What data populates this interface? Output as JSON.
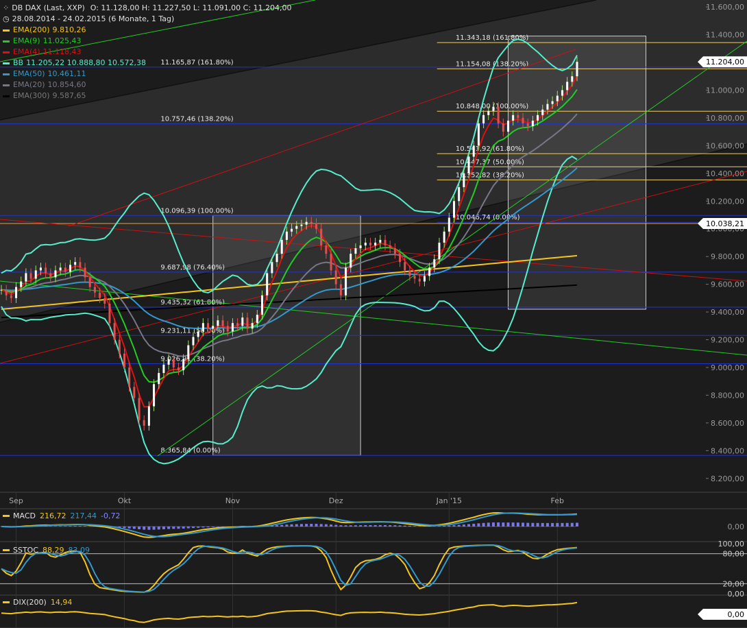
{
  "header": {
    "title": "DB DAX (Last, XXP)",
    "ohlc": "O: 11.128,00  H: 11.227,50  L: 11.091,00  C: 11.204,00",
    "period": "28.08.2014 - 24.02.2015 (6 Monate, 1 Tag)"
  },
  "legend": [
    {
      "label": "EMA(200)",
      "value": "9.810,26",
      "color": "#f5c518"
    },
    {
      "label": "EMA(9)",
      "value": "11.025,43",
      "color": "#22cc22"
    },
    {
      "label": "EMA(4)",
      "value": "11.118,43",
      "color": "#dd1111"
    },
    {
      "label": "BB",
      "value": "11.205,22  10.888,80  10.572,38",
      "color": "#55eecc"
    },
    {
      "label": "EMA(50)",
      "value": "10.461,11",
      "color": "#3399cc"
    },
    {
      "label": "EMA(20)",
      "value": "10.854,60",
      "color": "#777788"
    },
    {
      "label": "EMA(300)",
      "value": "9.587,65",
      "color": "#111111"
    }
  ],
  "price_badges": [
    {
      "value": "11.204,00",
      "price": 11204
    },
    {
      "value": "10.038,21",
      "price": 10038
    }
  ],
  "chart_data": {
    "type": "line",
    "title": "DB DAX (Last, XXP)",
    "ylim": [
      8100,
      11650
    ],
    "y_ticks": [
      {
        "v": 8200,
        "label": "8.200,00"
      },
      {
        "v": 8400,
        "label": "8.400,00"
      },
      {
        "v": 8600,
        "label": "8.600,00"
      },
      {
        "v": 8800,
        "label": "8.800,00"
      },
      {
        "v": 9000,
        "label": "9.000,00"
      },
      {
        "v": 9200,
        "label": "9.200,00"
      },
      {
        "v": 9400,
        "label": "9.400,00"
      },
      {
        "v": 9600,
        "label": "9.600,00"
      },
      {
        "v": 9800,
        "label": "9.800,00"
      },
      {
        "v": 10000,
        "label": "10.000,00"
      },
      {
        "v": 10200,
        "label": "10.200,00"
      },
      {
        "v": 10400,
        "label": "10.400,00"
      },
      {
        "v": 10600,
        "label": "10.600,00"
      },
      {
        "v": 10800,
        "label": "10.800,00"
      },
      {
        "v": 11000,
        "label": "11.000,00"
      },
      {
        "v": 11200,
        "label": "11.200,00"
      },
      {
        "v": 11400,
        "label": "11.400,00"
      },
      {
        "v": 11600,
        "label": "11.600,00"
      }
    ],
    "x_labels": [
      {
        "i": 3,
        "label": "Sep"
      },
      {
        "i": 25,
        "label": "Okt"
      },
      {
        "i": 47,
        "label": "Nov"
      },
      {
        "i": 68,
        "label": "Dez"
      },
      {
        "i": 91,
        "label": "Jan '15"
      },
      {
        "i": 113,
        "label": "Feb"
      }
    ],
    "fib_levels": [
      {
        "price": 11343,
        "label": "11.343,18 (161.80%)",
        "color": "#f0d060",
        "x0": 0.585,
        "labelX": 0.61
      },
      {
        "price": 11154,
        "label": "11.154,08 (138.20%)",
        "color": "#f0d060",
        "x0": 0.585,
        "labelX": 0.61
      },
      {
        "price": 11166,
        "label": "11.165,87 (161.80%)",
        "color": "#2233cc",
        "x0": 0.0,
        "labelX": 0.215
      },
      {
        "price": 10848,
        "label": "10.848,00 (100.00%)",
        "color": "#f0d060",
        "x0": 0.585,
        "labelX": 0.61
      },
      {
        "price": 10757,
        "label": "10.757,46 (138.20%)",
        "color": "#2233cc",
        "x0": 0.0,
        "labelX": 0.215
      },
      {
        "price": 10542,
        "label": "10.541,92 (61.80%)",
        "color": "#f0d060",
        "x0": 0.585,
        "labelX": 0.61
      },
      {
        "price": 10447,
        "label": "10.447,37 (50.00%)",
        "color": "#f0d060",
        "x0": 0.585,
        "labelX": 0.61
      },
      {
        "price": 10353,
        "label": "10.352,82 (38.20%)",
        "color": "#f0d060",
        "x0": 0.585,
        "labelX": 0.61
      },
      {
        "price": 10096,
        "label": "10.096,39 (100.00%)",
        "color": "#2233cc",
        "x0": 0.0,
        "labelX": 0.215
      },
      {
        "price": 10047,
        "label": "10.046,74 (0.00%)",
        "color": "#2233cc",
        "x0": 0.585,
        "labelX": 0.61
      },
      {
        "price": 9688,
        "label": "9.687,98 (76.40%)",
        "color": "#2233cc",
        "x0": 0.0,
        "labelX": 0.215
      },
      {
        "price": 9435,
        "label": "9.435,32 (61.80%)",
        "color": "#2233cc",
        "x0": 0.0,
        "labelX": 0.215
      },
      {
        "price": 9231,
        "label": "9.231,11 (50.00%)",
        "color": "#2233cc",
        "x0": 0.0,
        "labelX": 0.215
      },
      {
        "price": 9027,
        "label": "9.026,91 (38.20%)",
        "color": "#2233cc",
        "x0": 0.0,
        "labelX": 0.215
      },
      {
        "price": 8366,
        "label": "8.365,84 (0.00%)",
        "color": "#2233cc",
        "x0": 0.0,
        "labelX": 0.215
      }
    ],
    "support_line_price": 10038,
    "fib_boxes": [
      {
        "i0": 43,
        "i1": 73,
        "top": 10096,
        "bottom": 8366
      },
      {
        "i0": 103,
        "i1": 131,
        "top": 11390,
        "bottom": 9420
      }
    ],
    "close": [
      9560,
      9520,
      9500,
      9580,
      9620,
      9680,
      9640,
      9700,
      9720,
      9680,
      9650,
      9700,
      9720,
      9690,
      9740,
      9760,
      9720,
      9650,
      9580,
      9540,
      9500,
      9460,
      9320,
      9200,
      9100,
      9000,
      8860,
      8780,
      8620,
      8580,
      8720,
      8880,
      8960,
      9020,
      9060,
      9000,
      8980,
      9060,
      9160,
      9220,
      9260,
      9320,
      9280,
      9300,
      9340,
      9300,
      9260,
      9320,
      9300,
      9360,
      9280,
      9320,
      9380,
      9520,
      9680,
      9760,
      9820,
      9920,
      9980,
      10000,
      10020,
      10030,
      10050,
      10040,
      10000,
      9880,
      9820,
      9700,
      9600,
      9520,
      9720,
      9820,
      9860,
      9880,
      9900,
      9880,
      9900,
      9920,
      9880,
      9860,
      9820,
      9760,
      9700,
      9660,
      9640,
      9620,
      9660,
      9720,
      9780,
      9900,
      9980,
      10080,
      10200,
      10300,
      10400,
      10520,
      10600,
      10760,
      10820,
      10850,
      10880,
      10760,
      10700,
      10780,
      10820,
      10800,
      10760,
      10740,
      10780,
      10820,
      10860,
      10900,
      10920,
      10960,
      11000,
      11060,
      11100,
      11204
    ]
  },
  "subcharts": [
    {
      "name": "MACD",
      "value1": "216,72",
      "value2": "217,44",
      "value3": "-0,72",
      "tick": "0,00"
    },
    {
      "name": "SSTOC",
      "value1": "88,29",
      "value2": "83,09",
      "tick_top": "100,00",
      "tick80": "80,00",
      "tick20": "20,00",
      "tick_bot": "0,00"
    },
    {
      "name": "DIX(200)",
      "value1": "14,94",
      "tick": "0,00"
    }
  ]
}
